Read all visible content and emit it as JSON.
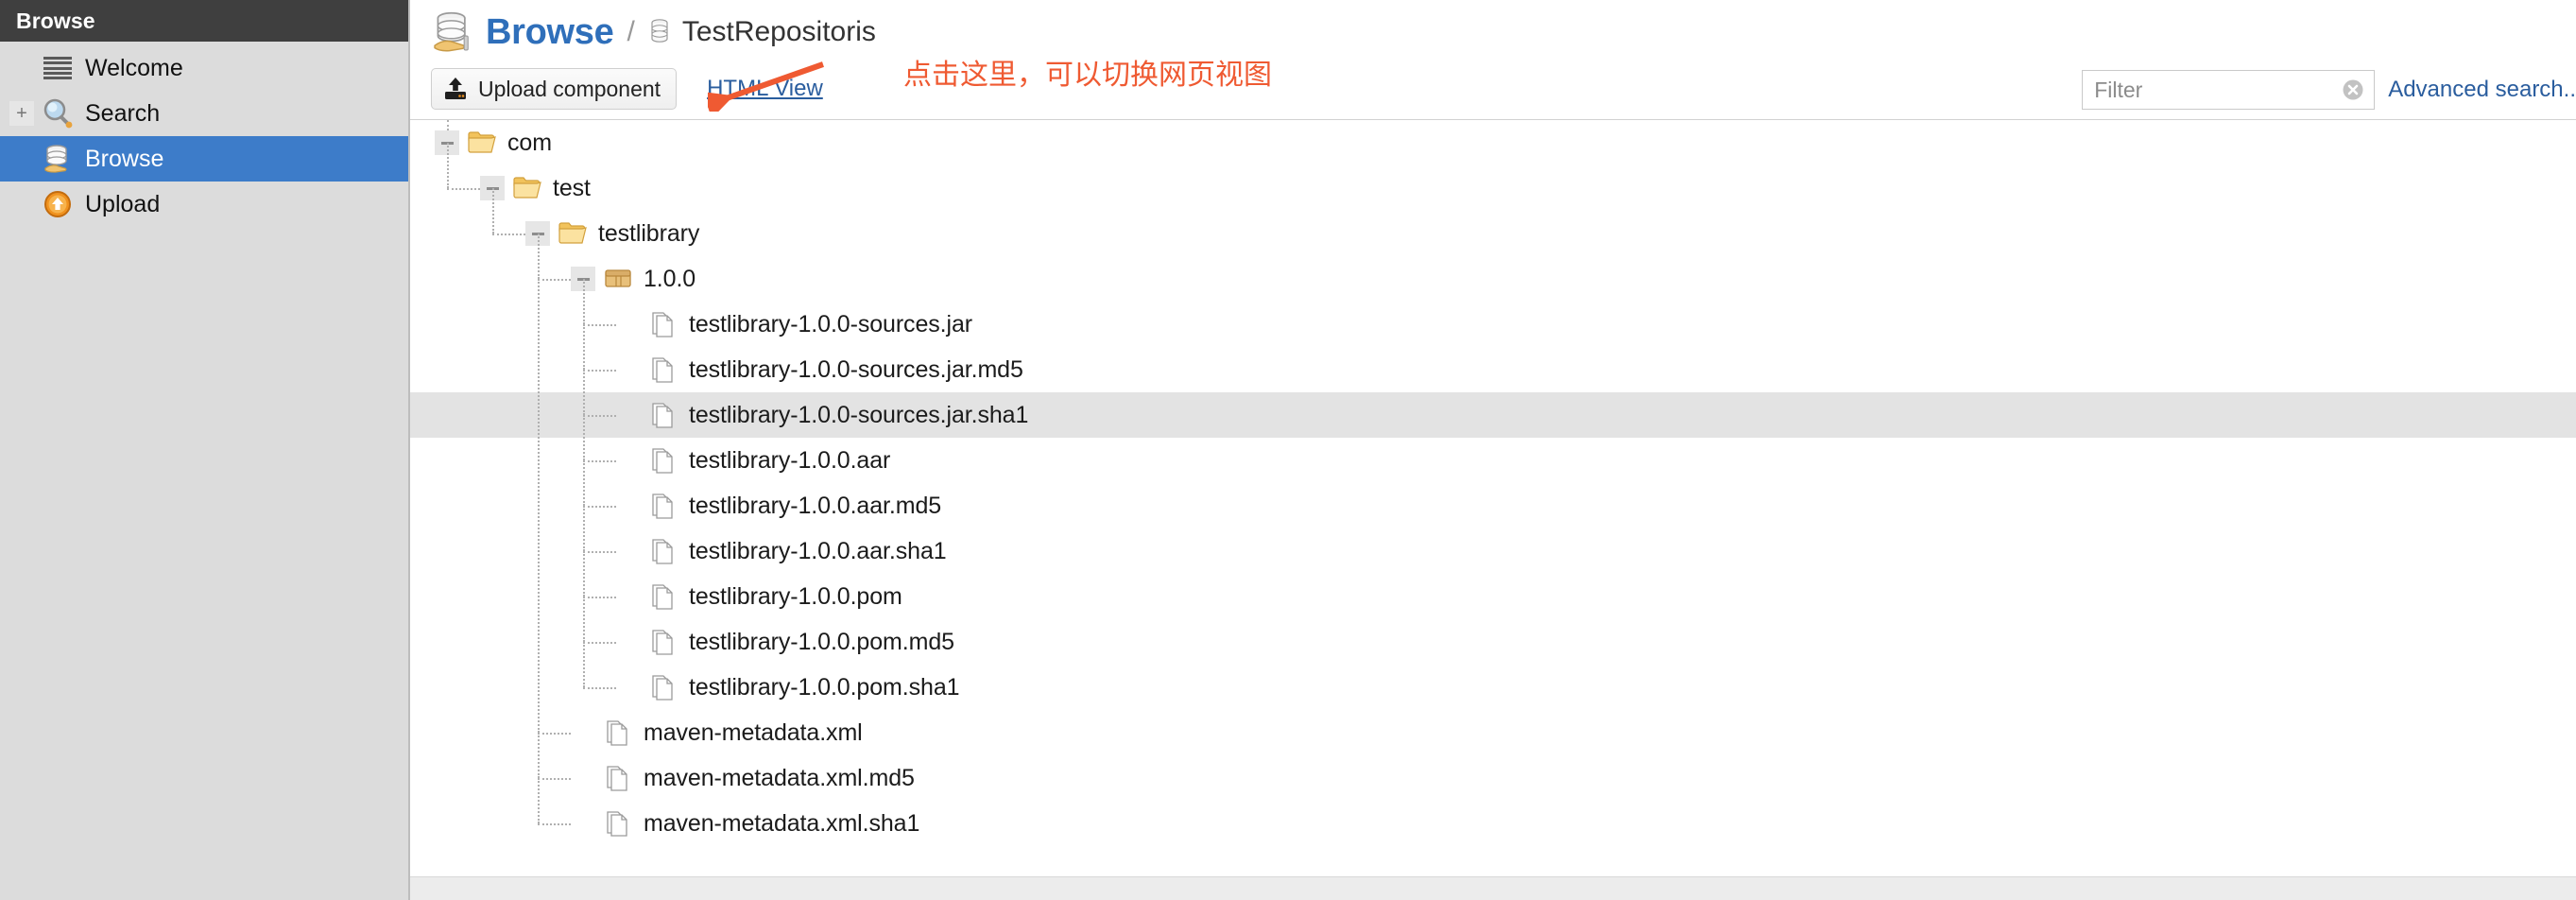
{
  "sidebar": {
    "header_title": "Browse",
    "items": [
      {
        "label": "Welcome",
        "icon": "lines-icon",
        "expander": "",
        "selected": false
      },
      {
        "label": "Search",
        "icon": "search-icon",
        "expander": "+",
        "selected": false
      },
      {
        "label": "Browse",
        "icon": "database-hand-icon",
        "expander": "",
        "selected": true
      },
      {
        "label": "Upload",
        "icon": "upload-circle-icon",
        "expander": "",
        "selected": false
      }
    ]
  },
  "header": {
    "title": "Browse",
    "breadcrumb_separator": "/",
    "repository": "TestRepositoris",
    "title_color": "#2f6fba"
  },
  "toolbar": {
    "upload_label": "Upload component",
    "html_view_label": "HTML View",
    "annotation_text": "点击这里，可以切换网页视图",
    "annotation_color": "#ef5a32"
  },
  "search": {
    "filter_value": "",
    "filter_placeholder": "Filter",
    "advanced_search_label": "Advanced search..",
    "clear_icon": "clear-circle-icon"
  },
  "tree": {
    "selected_index": 6,
    "nodes": [
      {
        "label": "com",
        "depth": 0,
        "type": "folder",
        "expanded": true
      },
      {
        "label": "test",
        "depth": 1,
        "type": "folder",
        "expanded": true
      },
      {
        "label": "testlibrary",
        "depth": 2,
        "type": "folder",
        "expanded": true
      },
      {
        "label": "1.0.0",
        "depth": 3,
        "type": "package",
        "expanded": true
      },
      {
        "label": "testlibrary-1.0.0-sources.jar",
        "depth": 4,
        "type": "file"
      },
      {
        "label": "testlibrary-1.0.0-sources.jar.md5",
        "depth": 4,
        "type": "file"
      },
      {
        "label": "testlibrary-1.0.0-sources.jar.sha1",
        "depth": 4,
        "type": "file"
      },
      {
        "label": "testlibrary-1.0.0.aar",
        "depth": 4,
        "type": "file"
      },
      {
        "label": "testlibrary-1.0.0.aar.md5",
        "depth": 4,
        "type": "file"
      },
      {
        "label": "testlibrary-1.0.0.aar.sha1",
        "depth": 4,
        "type": "file"
      },
      {
        "label": "testlibrary-1.0.0.pom",
        "depth": 4,
        "type": "file"
      },
      {
        "label": "testlibrary-1.0.0.pom.md5",
        "depth": 4,
        "type": "file"
      },
      {
        "label": "testlibrary-1.0.0.pom.sha1",
        "depth": 4,
        "type": "file"
      },
      {
        "label": "maven-metadata.xml",
        "depth": 3,
        "type": "file"
      },
      {
        "label": "maven-metadata.xml.md5",
        "depth": 3,
        "type": "file"
      },
      {
        "label": "maven-metadata.xml.sha1",
        "depth": 3,
        "type": "file"
      }
    ]
  },
  "colors": {
    "sidebar_bg": "#dcdcdc",
    "sidebar_header_bg": "#3f3f3f",
    "selection_blue": "#3d7cc9",
    "row_highlight": "#e3e3e3",
    "link_blue": "#2a5d9e",
    "folder_yellow": "#f0c14b"
  }
}
